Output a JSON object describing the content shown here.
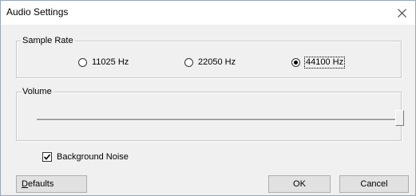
{
  "window": {
    "title": "Audio Settings",
    "close_glyph": "✕"
  },
  "sample_rate": {
    "legend": "Sample Rate",
    "options": [
      {
        "label": "11025 Hz",
        "selected": false
      },
      {
        "label": "22050 Hz",
        "selected": false
      },
      {
        "label": "44100 Hz",
        "selected": true
      }
    ]
  },
  "volume": {
    "legend": "Volume",
    "level": 1.0
  },
  "background_noise": {
    "label": "Background Noise",
    "checked": true
  },
  "buttons": {
    "defaults": "Defaults",
    "defaults_mnemonic": "D",
    "defaults_rest": "efaults",
    "ok": "OK",
    "cancel": "Cancel"
  },
  "icons": {
    "close": "close-icon",
    "checkmark": "checkmark-icon"
  }
}
